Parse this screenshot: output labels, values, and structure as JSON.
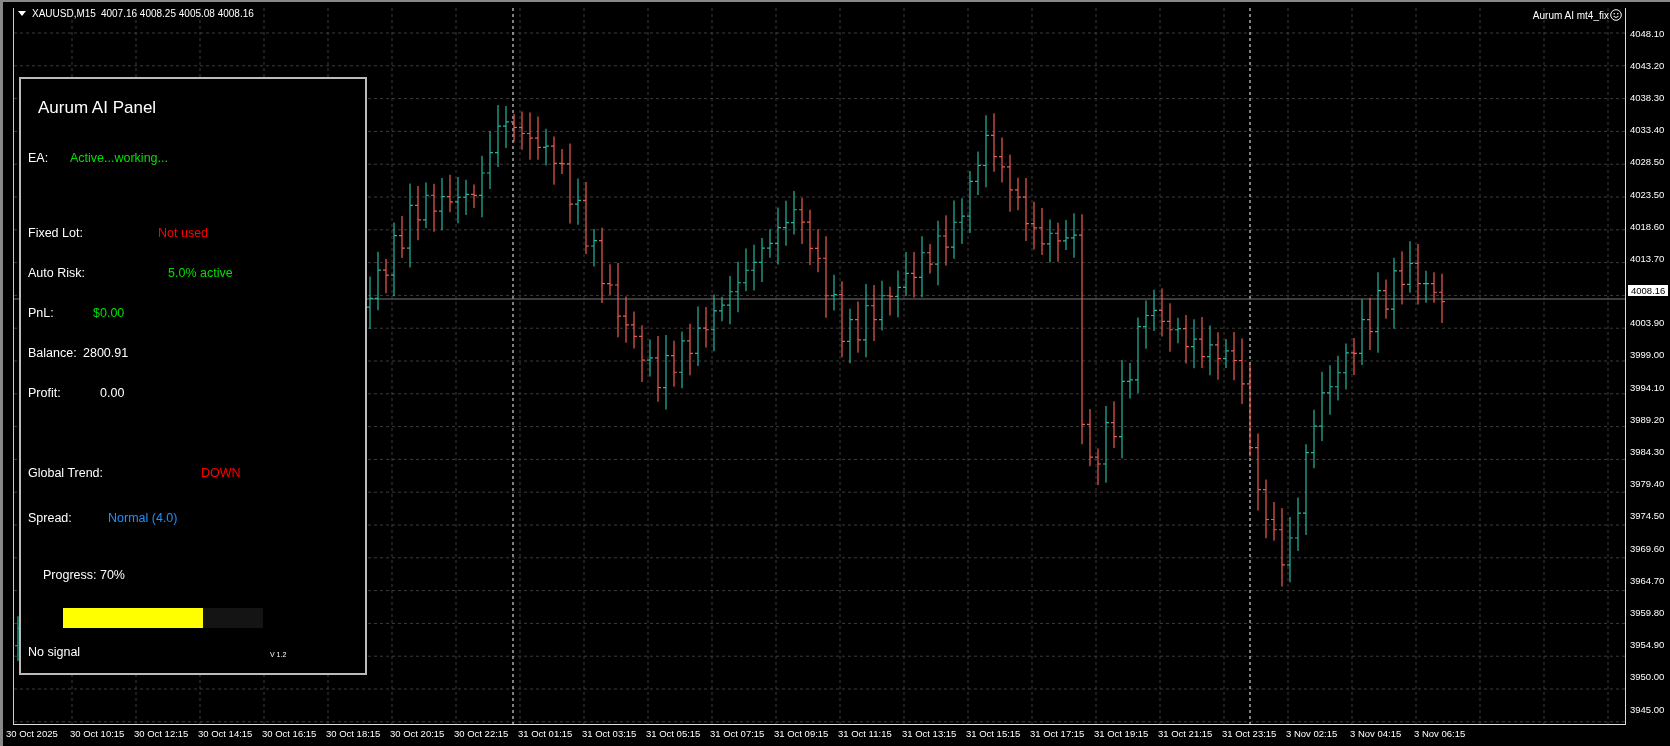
{
  "chart": {
    "symbol": "XAUUSD,M15",
    "ohlc": "4007.16 4008.25 4005.08 4008.16",
    "expert": "Aurum AI mt4_fix"
  },
  "price_axis": [
    {
      "text": "4048.10",
      "kind": "tick"
    },
    {
      "text": "4043.20",
      "kind": "tick"
    },
    {
      "text": "4038.30",
      "kind": "tick"
    },
    {
      "text": "4033.40",
      "kind": "tick"
    },
    {
      "text": "4028.50",
      "kind": "tick"
    },
    {
      "text": "4023.50",
      "kind": "tick"
    },
    {
      "text": "4018.60",
      "kind": "tick"
    },
    {
      "text": "4013.70",
      "kind": "tick"
    },
    {
      "text": "4008.16",
      "kind": "current"
    },
    {
      "text": "4003.90",
      "kind": "tick"
    },
    {
      "text": "3999.00",
      "kind": "tick"
    },
    {
      "text": "3994.10",
      "kind": "tick"
    },
    {
      "text": "3989.20",
      "kind": "tick"
    },
    {
      "text": "3984.30",
      "kind": "tick"
    },
    {
      "text": "3979.40",
      "kind": "tick"
    },
    {
      "text": "3974.50",
      "kind": "tick"
    },
    {
      "text": "3969.60",
      "kind": "tick"
    },
    {
      "text": "3964.70",
      "kind": "tick"
    },
    {
      "text": "3959.80",
      "kind": "tick"
    },
    {
      "text": "3954.90",
      "kind": "tick"
    },
    {
      "text": "3950.00",
      "kind": "tick"
    },
    {
      "text": "3945.00",
      "kind": "tick"
    }
  ],
  "time_axis": [
    "30 Oct 2025",
    "30 Oct 10:15",
    "30 Oct 12:15",
    "30 Oct 14:15",
    "30 Oct 16:15",
    "30 Oct 18:15",
    "30 Oct 20:15",
    "30 Oct 22:15",
    "31 Oct 01:15",
    "31 Oct 03:15",
    "31 Oct 05:15",
    "31 Oct 07:15",
    "31 Oct 09:15",
    "31 Oct 11:15",
    "31 Oct 13:15",
    "31 Oct 15:15",
    "31 Oct 17:15",
    "31 Oct 19:15",
    "31 Oct 21:15",
    "31 Oct 23:15",
    "3 Nov 02:15",
    "3 Nov 04:15",
    "3 Nov 06:15"
  ],
  "panel": {
    "title": "Aurum AI Panel",
    "sections": [
      [
        {
          "label": "EA:",
          "value": "Active...working...",
          "color": "#00e000"
        }
      ],
      [
        {
          "label": "Fixed Lot:",
          "value": "Not used",
          "color": "#ff0000"
        },
        {
          "label": "Auto Risk:",
          "value": "5.0% active",
          "color": "#00e000"
        },
        {
          "label": "PnL:",
          "value": "$0.00",
          "color": "#00e000"
        },
        {
          "label": "Balance:",
          "value": "2800.91",
          "color": "#ffffff"
        },
        {
          "label": "Profit:",
          "value": "0.00",
          "color": "#ffffff"
        }
      ],
      [
        {
          "label": "Global Trend:",
          "value": "DOWN",
          "color": "#ff0000"
        },
        {
          "label": "Spread:",
          "value": "Normal (4.0)",
          "color": "#1e90ff"
        }
      ]
    ],
    "progress": {
      "label": "Progress: 70%",
      "level": 0.7
    },
    "signal": "No signal",
    "version": "V 1.2"
  }
}
